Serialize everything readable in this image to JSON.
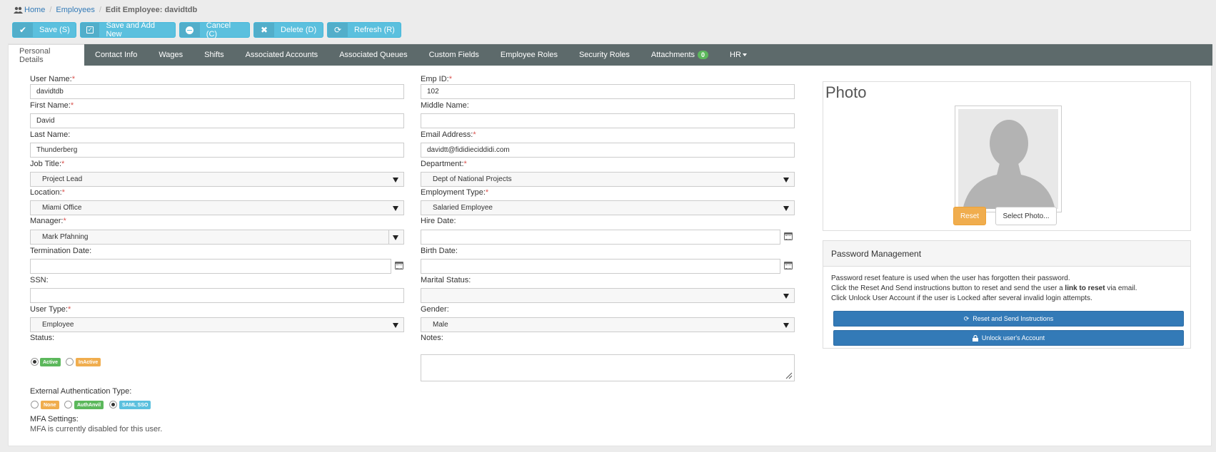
{
  "breadcrumb": {
    "home": "Home",
    "employees": "Employees",
    "current": "Edit Employee: davidtdb"
  },
  "toolbar": {
    "save": "Save (S)",
    "save_add": "Save and Add New",
    "cancel": "Cancel (C)",
    "delete": "Delete (D)",
    "refresh": "Refresh (R)"
  },
  "tabs": [
    "Personal Details",
    "Contact Info",
    "Wages",
    "Shifts",
    "Associated Accounts",
    "Associated Queues",
    "Custom Fields",
    "Employee Roles",
    "Security Roles",
    "Attachments",
    "HR"
  ],
  "attachments_count": "0",
  "form": {
    "user_name": {
      "label": "User Name:",
      "value": "davidtdb"
    },
    "first_name": {
      "label": "First Name:",
      "value": "David"
    },
    "last_name": {
      "label": "Last Name:",
      "value": "Thunderberg"
    },
    "job_title": {
      "label": "Job Title:",
      "value": "Project Lead"
    },
    "location": {
      "label": "Location:",
      "value": "Miami Office"
    },
    "manager": {
      "label": "Manager:",
      "value": "Mark Pfahning"
    },
    "termination_date": {
      "label": "Termination Date:",
      "value": ""
    },
    "ssn": {
      "label": "SSN:",
      "value": ""
    },
    "user_type": {
      "label": "User Type:",
      "value": "Employee"
    },
    "status": {
      "label": "Status:",
      "active": "Active",
      "inactive": "InActive"
    },
    "ext_auth": {
      "label": "External Authentication Type:",
      "none": "None",
      "authanvil": "AuthAnvil",
      "saml": "SAML SSO"
    },
    "mfa": {
      "label": "MFA Settings:",
      "text": "MFA is currently disabled for this user."
    },
    "emp_id": {
      "label": "Emp ID:",
      "value": "102"
    },
    "middle_name": {
      "label": "Middle Name:",
      "value": ""
    },
    "email": {
      "label": "Email Address:",
      "value": "davidtt@fididieciddidi.com"
    },
    "department": {
      "label": "Department:",
      "value": "Dept of National Projects"
    },
    "employment_type": {
      "label": "Employment Type:",
      "value": "Salaried Employee"
    },
    "hire_date": {
      "label": "Hire Date:",
      "value": ""
    },
    "birth_date": {
      "label": "Birth Date:",
      "value": ""
    },
    "marital_status": {
      "label": "Marital Status:",
      "value": ""
    },
    "gender": {
      "label": "Gender:",
      "value": "Male"
    },
    "notes": {
      "label": "Notes:",
      "value": ""
    }
  },
  "photo": {
    "title": "Photo",
    "reset": "Reset",
    "select": "Select Photo..."
  },
  "password": {
    "title": "Password Management",
    "line1": "Password reset feature is used when the user has forgotten their password.",
    "line2_pre": "Click the Reset And Send instructions button to reset and send the user a ",
    "line2_bold": "link to reset",
    "line2_post": " via email.",
    "line3": "Click Unlock User Account if the user is Locked after several invalid login attempts.",
    "reset_btn": "Reset and Send Instructions",
    "unlock_btn": "Unlock user's Account"
  },
  "required_marker": "*"
}
